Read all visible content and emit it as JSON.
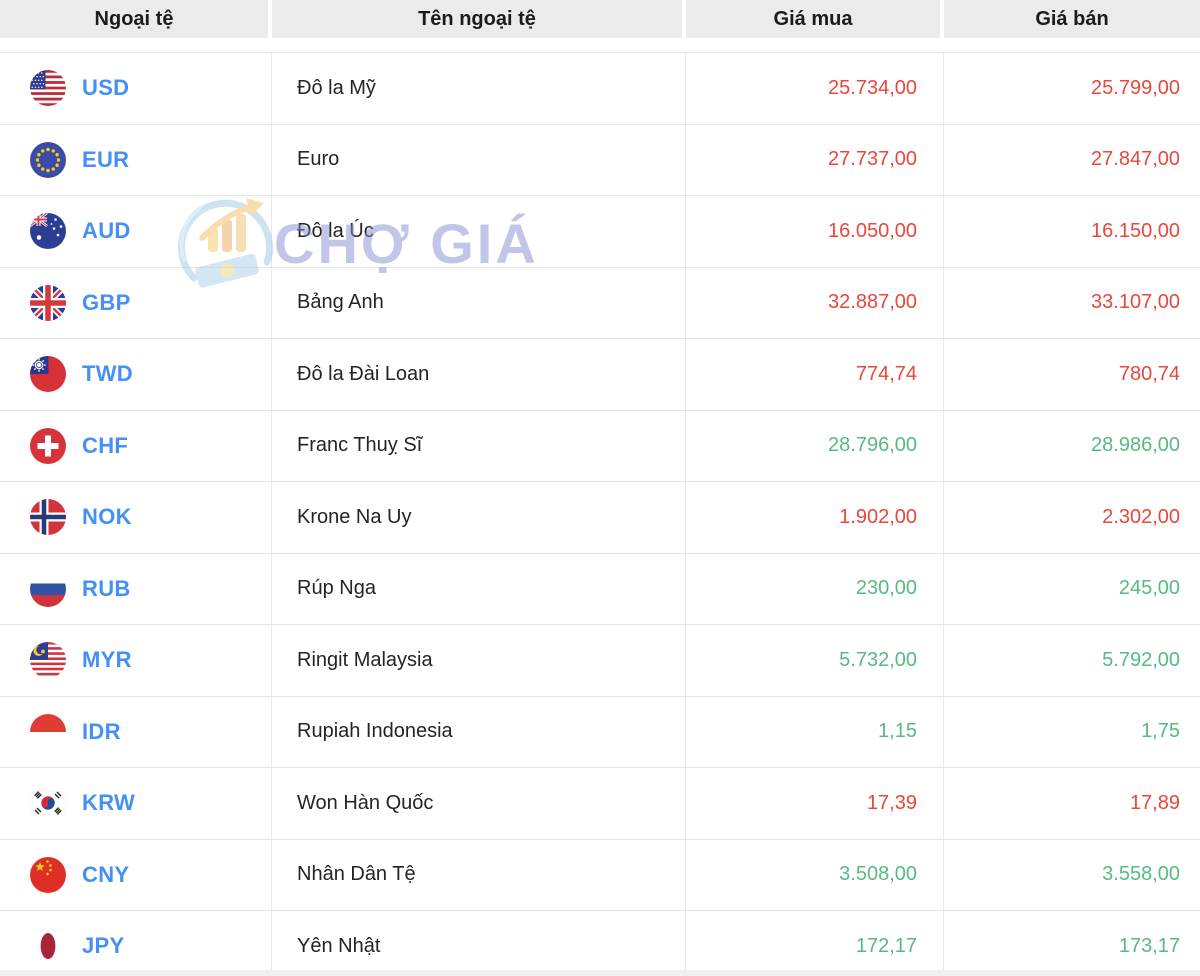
{
  "table": {
    "columns": [
      {
        "label": "Ngoại tệ"
      },
      {
        "label": "Tên ngoại tệ"
      },
      {
        "label": "Giá mua"
      },
      {
        "label": "Giá bán"
      }
    ],
    "rows": [
      {
        "code": "USD",
        "flag_icon": "usd-flag-icon",
        "name": "Đô la Mỹ",
        "buy": "25.734,00",
        "sell": "25.799,00",
        "value_color": "red"
      },
      {
        "code": "EUR",
        "flag_icon": "eur-flag-icon",
        "name": "Euro",
        "buy": "27.737,00",
        "sell": "27.847,00",
        "value_color": "red"
      },
      {
        "code": "AUD",
        "flag_icon": "aud-flag-icon",
        "name": "Đô la Úc",
        "buy": "16.050,00",
        "sell": "16.150,00",
        "value_color": "red"
      },
      {
        "code": "GBP",
        "flag_icon": "gbp-flag-icon",
        "name": "Bảng Anh",
        "buy": "32.887,00",
        "sell": "33.107,00",
        "value_color": "red"
      },
      {
        "code": "TWD",
        "flag_icon": "twd-flag-icon",
        "name": "Đô la Đài Loan",
        "buy": "774,74",
        "sell": "780,74",
        "value_color": "red"
      },
      {
        "code": "CHF",
        "flag_icon": "chf-flag-icon",
        "name": "Franc Thuỵ Sĩ",
        "buy": "28.796,00",
        "sell": "28.986,00",
        "value_color": "green"
      },
      {
        "code": "NOK",
        "flag_icon": "nok-flag-icon",
        "name": "Krone Na Uy",
        "buy": "1.902,00",
        "sell": "2.302,00",
        "value_color": "red"
      },
      {
        "code": "RUB",
        "flag_icon": "rub-flag-icon",
        "name": "Rúp Nga",
        "buy": "230,00",
        "sell": "245,00",
        "value_color": "green"
      },
      {
        "code": "MYR",
        "flag_icon": "myr-flag-icon",
        "name": "Ringit Malaysia",
        "buy": "5.732,00",
        "sell": "5.792,00",
        "value_color": "green"
      },
      {
        "code": "IDR",
        "flag_icon": "idr-flag-icon",
        "name": "Rupiah Indonesia",
        "buy": "1,15",
        "sell": "1,75",
        "value_color": "green"
      },
      {
        "code": "KRW",
        "flag_icon": "krw-flag-icon",
        "name": "Won Hàn Quốc",
        "buy": "17,39",
        "sell": "17,89",
        "value_color": "red"
      },
      {
        "code": "CNY",
        "flag_icon": "cny-flag-icon",
        "name": "Nhân Dân Tệ",
        "buy": "3.508,00",
        "sell": "3.558,00",
        "value_color": "green"
      },
      {
        "code": "JPY",
        "flag_icon": "jpy-flag-icon",
        "name": "Yên Nhật",
        "buy": "172,17",
        "sell": "173,17",
        "value_color": "green"
      }
    ]
  },
  "watermark": {
    "text": "CHỢ GIÁ"
  },
  "colors": {
    "price_down_red": "#e8473a",
    "price_up_green": "#58b982",
    "currency_code_blue": "#4590f4",
    "header_bg": "#ebebeb"
  }
}
